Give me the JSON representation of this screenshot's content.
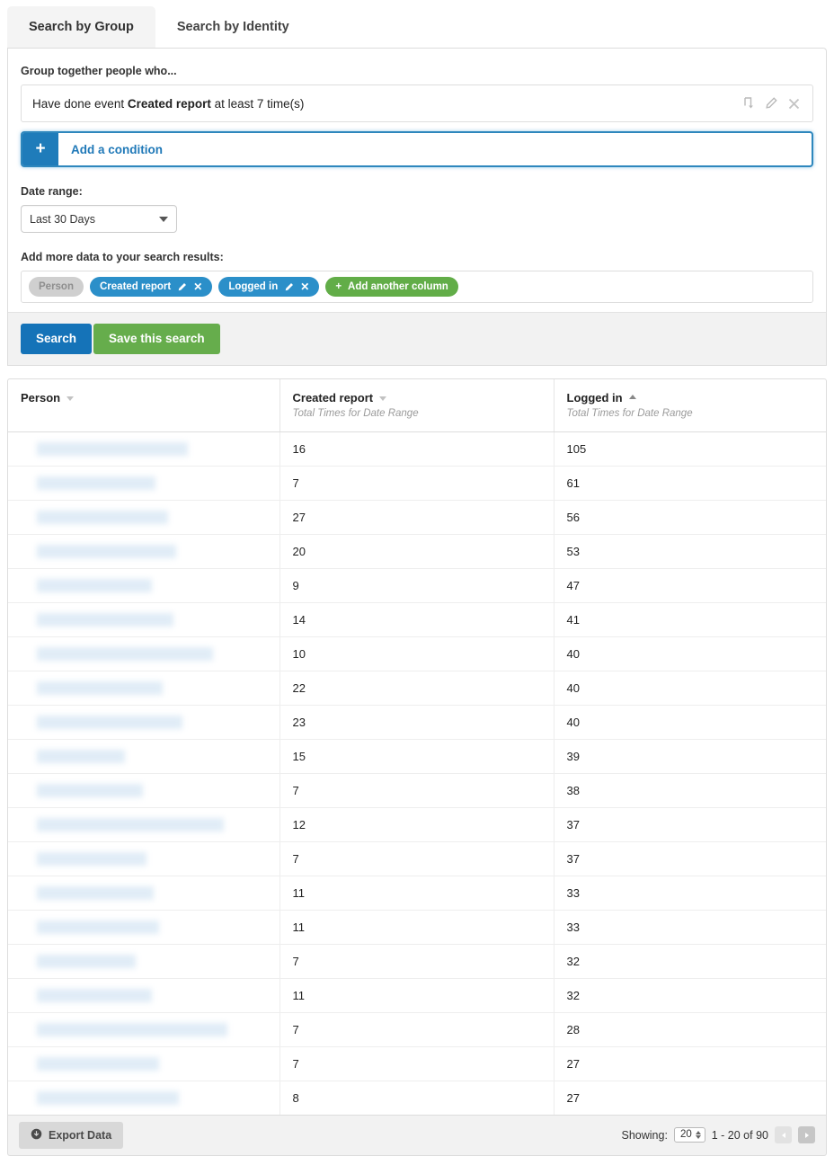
{
  "tabs": [
    {
      "label": "Search by Group",
      "active": true
    },
    {
      "label": "Search by Identity",
      "active": false
    }
  ],
  "builder": {
    "group_label": "Group together people who...",
    "condition": {
      "prefix": "Have done event",
      "event": "Created report",
      "suffix": "at least 7 time(s)",
      "icons": [
        "branch-icon",
        "pencil-icon",
        "close-icon"
      ]
    },
    "add_condition": {
      "plus": "+",
      "label": "Add a condition"
    },
    "date_range_label": "Date range:",
    "date_range_value": "Last 30 Days",
    "columns_label": "Add more data to your search results:",
    "columns": [
      {
        "label": "Person",
        "style": "grey",
        "removable": false
      },
      {
        "label": "Created report",
        "style": "blue",
        "removable": true
      },
      {
        "label": "Logged in",
        "style": "blue",
        "removable": true
      }
    ],
    "add_column_label": "Add another column"
  },
  "actions": {
    "search_label": "Search",
    "save_label": "Save this search"
  },
  "table": {
    "columns": [
      {
        "title": "Person",
        "subtitle": "",
        "sort": "none"
      },
      {
        "title": "Created report",
        "subtitle": "Total Times for Date Range",
        "sort": "none"
      },
      {
        "title": "Logged in",
        "subtitle": "Total Times for Date Range",
        "sort": "asc"
      }
    ],
    "rows": [
      {
        "person": "",
        "redact_w": 168,
        "created": "16",
        "logged": "105"
      },
      {
        "person": "",
        "redact_w": 132,
        "created": "7",
        "logged": "61"
      },
      {
        "person": "",
        "redact_w": 146,
        "created": "27",
        "logged": "56"
      },
      {
        "person": "",
        "redact_w": 155,
        "created": "20",
        "logged": "53"
      },
      {
        "person": "",
        "redact_w": 128,
        "created": "9",
        "logged": "47"
      },
      {
        "person": "",
        "redact_w": 152,
        "created": "14",
        "logged": "41"
      },
      {
        "person": "",
        "redact_w": 196,
        "created": "10",
        "logged": "40"
      },
      {
        "person": "",
        "redact_w": 140,
        "created": "22",
        "logged": "40"
      },
      {
        "person": "",
        "redact_w": 162,
        "created": "23",
        "logged": "40"
      },
      {
        "person": "",
        "redact_w": 98,
        "created": "15",
        "logged": "39"
      },
      {
        "person": "",
        "redact_w": 118,
        "created": "7",
        "logged": "38"
      },
      {
        "person": "",
        "redact_w": 208,
        "created": "12",
        "logged": "37"
      },
      {
        "person": "",
        "redact_w": 122,
        "created": "7",
        "logged": "37"
      },
      {
        "person": "",
        "redact_w": 130,
        "created": "11",
        "logged": "33"
      },
      {
        "person": "",
        "redact_w": 136,
        "created": "11",
        "logged": "33"
      },
      {
        "person": "",
        "redact_w": 110,
        "created": "7",
        "logged": "32"
      },
      {
        "person": "",
        "redact_w": 128,
        "created": "11",
        "logged": "32"
      },
      {
        "person": "",
        "redact_w": 212,
        "created": "7",
        "logged": "28"
      },
      {
        "person": "",
        "redact_w": 136,
        "created": "7",
        "logged": "27"
      },
      {
        "person": "",
        "redact_w": 158,
        "created": "8",
        "logged": "27"
      }
    ]
  },
  "footer": {
    "export_label": "Export Data",
    "export_icon": "download-circle-icon",
    "showing_label": "Showing:",
    "page_size": "20",
    "range_label": "1 - 20 of 90",
    "prev_icon": "prev-page-icon",
    "next_icon": "next-page-icon"
  },
  "colors": {
    "accent_blue": "#1f7cba",
    "pill_blue": "#2b8fc9",
    "green": "#62ad48",
    "search_blue": "#1573b8",
    "redact": "#d6e6f4"
  }
}
